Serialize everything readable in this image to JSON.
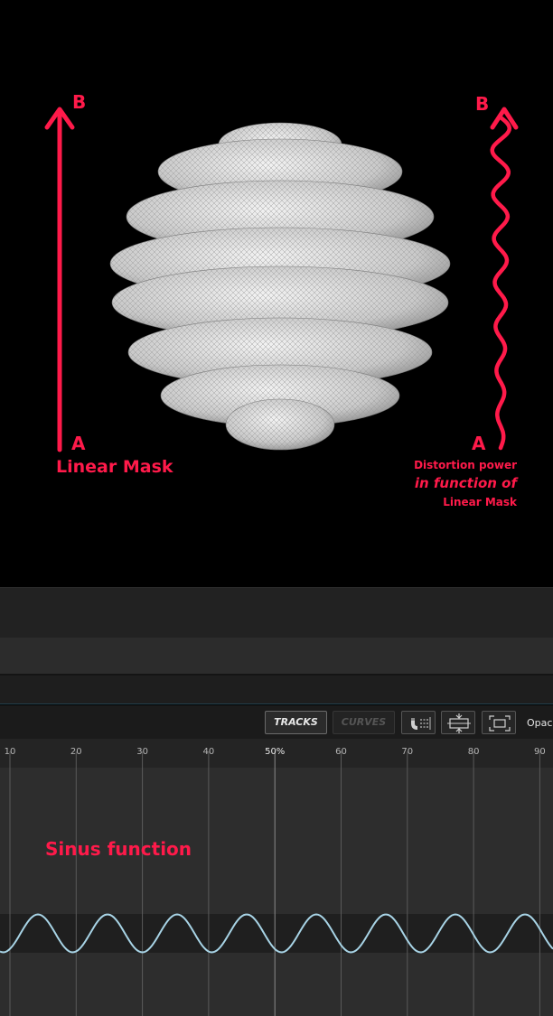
{
  "illustration": {
    "left_arrow": {
      "top_label": "B",
      "bottom_label": "A"
    },
    "right_arrow": {
      "top_label": "B",
      "bottom_label": "A"
    },
    "mask_label": "Linear Mask",
    "distortion_caption": {
      "line1": "Distortion power",
      "line2": "in function of",
      "line3": "Linear Mask"
    },
    "accent_color": "#ff1a4a",
    "shape_color": "#d9d9d9"
  },
  "toolbar": {
    "tracks_label": "TRACKS",
    "curves_label": "CURVES",
    "snap_icon": "magnet-snap-icon",
    "fit_icon": "fit-vertical-icon",
    "frame_icon": "frame-all-icon",
    "opacity_label": "Opaci"
  },
  "timeline": {
    "ruler_ticks": [
      "10",
      "20",
      "30",
      "40",
      "50%",
      "60",
      "70",
      "80",
      "90"
    ],
    "track_label": "Sinus function",
    "curve_color": "#a8d4e6"
  }
}
